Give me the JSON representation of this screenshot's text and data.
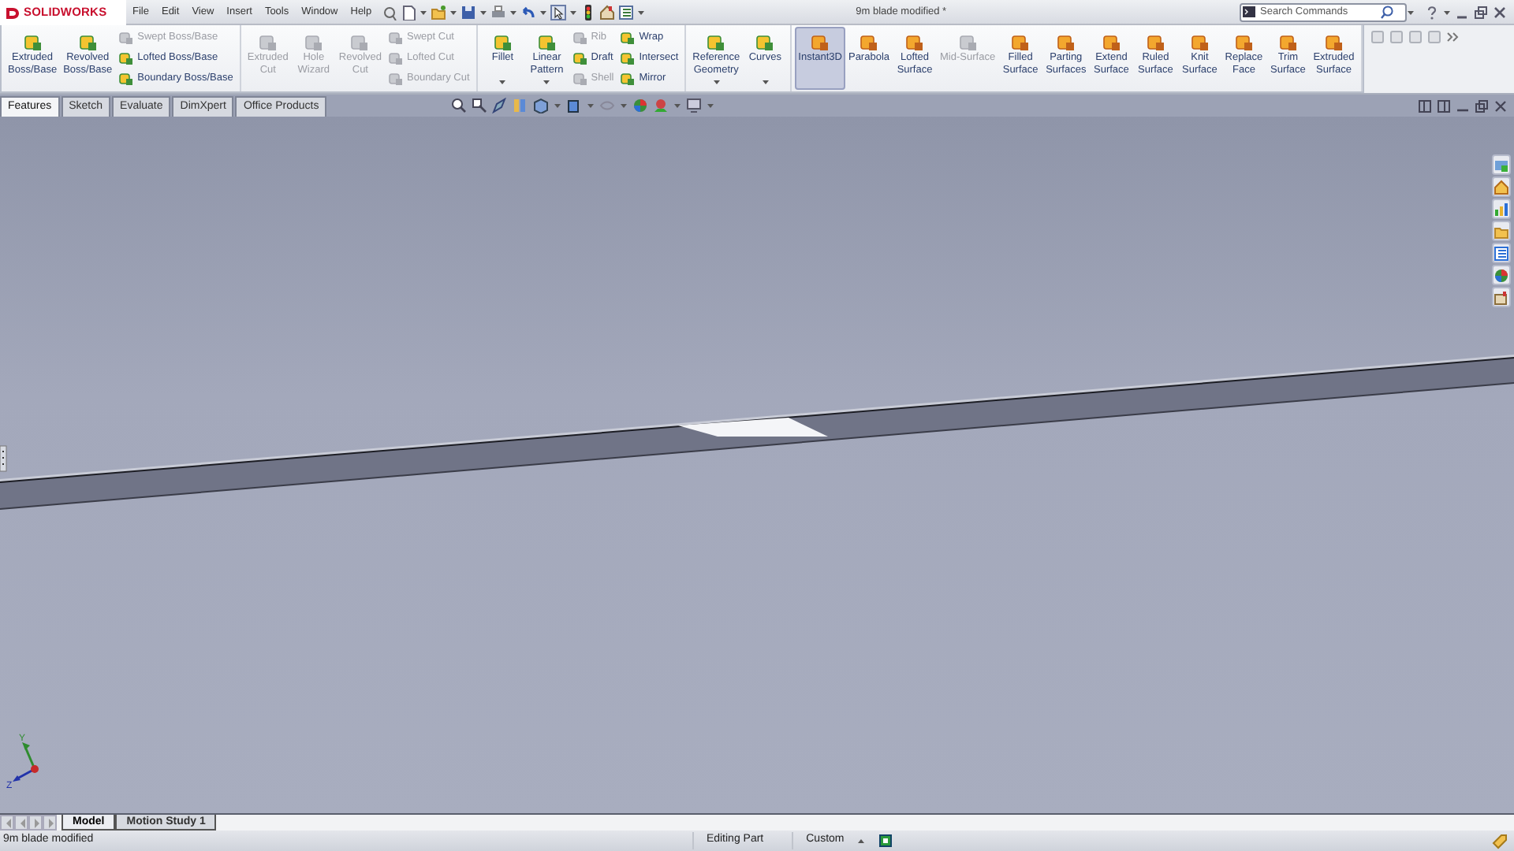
{
  "title_bar": {
    "logo": "SOLIDWORKS",
    "menu": [
      "File",
      "Edit",
      "View",
      "Insert",
      "Tools",
      "Window",
      "Help"
    ],
    "document_title": "9m blade modified *",
    "search": {
      "placeholder": "Search Commands"
    }
  },
  "ribbon": {
    "groups": [
      {
        "items": [
          {
            "kind": "large",
            "label": "Extruded\nBoss/Base",
            "disabled": false,
            "selected": false,
            "dropdown": false
          },
          {
            "kind": "large",
            "label": "Revolved\nBoss/Base",
            "disabled": false,
            "selected": false,
            "dropdown": false
          },
          {
            "kind": "stack",
            "items": [
              {
                "label": "Swept Boss/Base",
                "disabled": true
              },
              {
                "label": "Lofted Boss/Base",
                "disabled": false
              },
              {
                "label": "Boundary Boss/Base",
                "disabled": false
              }
            ]
          }
        ]
      },
      {
        "items": [
          {
            "kind": "large",
            "label": "Extruded\nCut",
            "disabled": true,
            "selected": false,
            "dropdown": false
          },
          {
            "kind": "large",
            "label": "Hole\nWizard",
            "disabled": true,
            "selected": false,
            "dropdown": false
          },
          {
            "kind": "large",
            "label": "Revolved\nCut",
            "disabled": true,
            "selected": false,
            "dropdown": false
          },
          {
            "kind": "stack",
            "items": [
              {
                "label": "Swept Cut",
                "disabled": true
              },
              {
                "label": "Lofted Cut",
                "disabled": true
              },
              {
                "label": "Boundary Cut",
                "disabled": true
              }
            ]
          }
        ]
      },
      {
        "items": [
          {
            "kind": "large",
            "label": "Fillet",
            "disabled": false,
            "selected": false,
            "dropdown": true
          },
          {
            "kind": "large",
            "label": "Linear\nPattern",
            "disabled": false,
            "selected": false,
            "dropdown": true
          },
          {
            "kind": "stack",
            "items": [
              {
                "label": "Rib",
                "disabled": true
              },
              {
                "label": "Draft",
                "disabled": false
              },
              {
                "label": "Shell",
                "disabled": true
              }
            ]
          },
          {
            "kind": "stack",
            "items": [
              {
                "label": "Wrap",
                "disabled": false
              },
              {
                "label": "Intersect",
                "disabled": false
              },
              {
                "label": "Mirror",
                "disabled": false
              }
            ]
          }
        ]
      },
      {
        "items": [
          {
            "kind": "large",
            "label": "Reference\nGeometry",
            "disabled": false,
            "selected": false,
            "dropdown": true
          },
          {
            "kind": "large",
            "label": "Curves",
            "disabled": false,
            "selected": false,
            "dropdown": true
          }
        ]
      },
      {
        "items": [
          {
            "kind": "large",
            "label": "Instant3D",
            "disabled": false,
            "selected": true,
            "dropdown": false
          },
          {
            "kind": "large",
            "label": "Parabola",
            "disabled": false,
            "selected": false,
            "dropdown": false
          },
          {
            "kind": "large",
            "label": "Lofted\nSurface",
            "disabled": false,
            "selected": false,
            "dropdown": false
          },
          {
            "kind": "large",
            "label": "Mid-Surface",
            "disabled": true,
            "selected": false,
            "dropdown": false
          },
          {
            "kind": "large",
            "label": "Filled\nSurface",
            "disabled": false,
            "selected": false,
            "dropdown": false
          },
          {
            "kind": "large",
            "label": "Parting\nSurfaces",
            "disabled": false,
            "selected": false,
            "dropdown": false
          },
          {
            "kind": "large",
            "label": "Extend\nSurface",
            "disabled": false,
            "selected": false,
            "dropdown": false
          },
          {
            "kind": "large",
            "label": "Ruled\nSurface",
            "disabled": false,
            "selected": false,
            "dropdown": false
          },
          {
            "kind": "large",
            "label": "Knit\nSurface",
            "disabled": false,
            "selected": false,
            "dropdown": false
          },
          {
            "kind": "large",
            "label": "Replace\nFace",
            "disabled": false,
            "selected": false,
            "dropdown": false
          },
          {
            "kind": "large",
            "label": "Trim\nSurface",
            "disabled": false,
            "selected": false,
            "dropdown": false
          },
          {
            "kind": "large",
            "label": "Extruded\nSurface",
            "disabled": false,
            "selected": false,
            "dropdown": false
          }
        ]
      }
    ]
  },
  "tabs": [
    {
      "label": "Features",
      "selected": true
    },
    {
      "label": "Sketch",
      "selected": false
    },
    {
      "label": "Evaluate",
      "selected": false
    },
    {
      "label": "DimXpert",
      "selected": false
    },
    {
      "label": "Office Products",
      "selected": false
    }
  ],
  "viewport": {
    "triad": {
      "y_label": "Y",
      "z_label": "Z"
    }
  },
  "bottom_tabs": [
    {
      "label": "Model",
      "selected": true
    },
    {
      "label": "Motion Study 1",
      "selected": false
    }
  ],
  "status_bar": {
    "document": "9m blade modified",
    "mode": "Editing Part",
    "units": "Custom"
  }
}
